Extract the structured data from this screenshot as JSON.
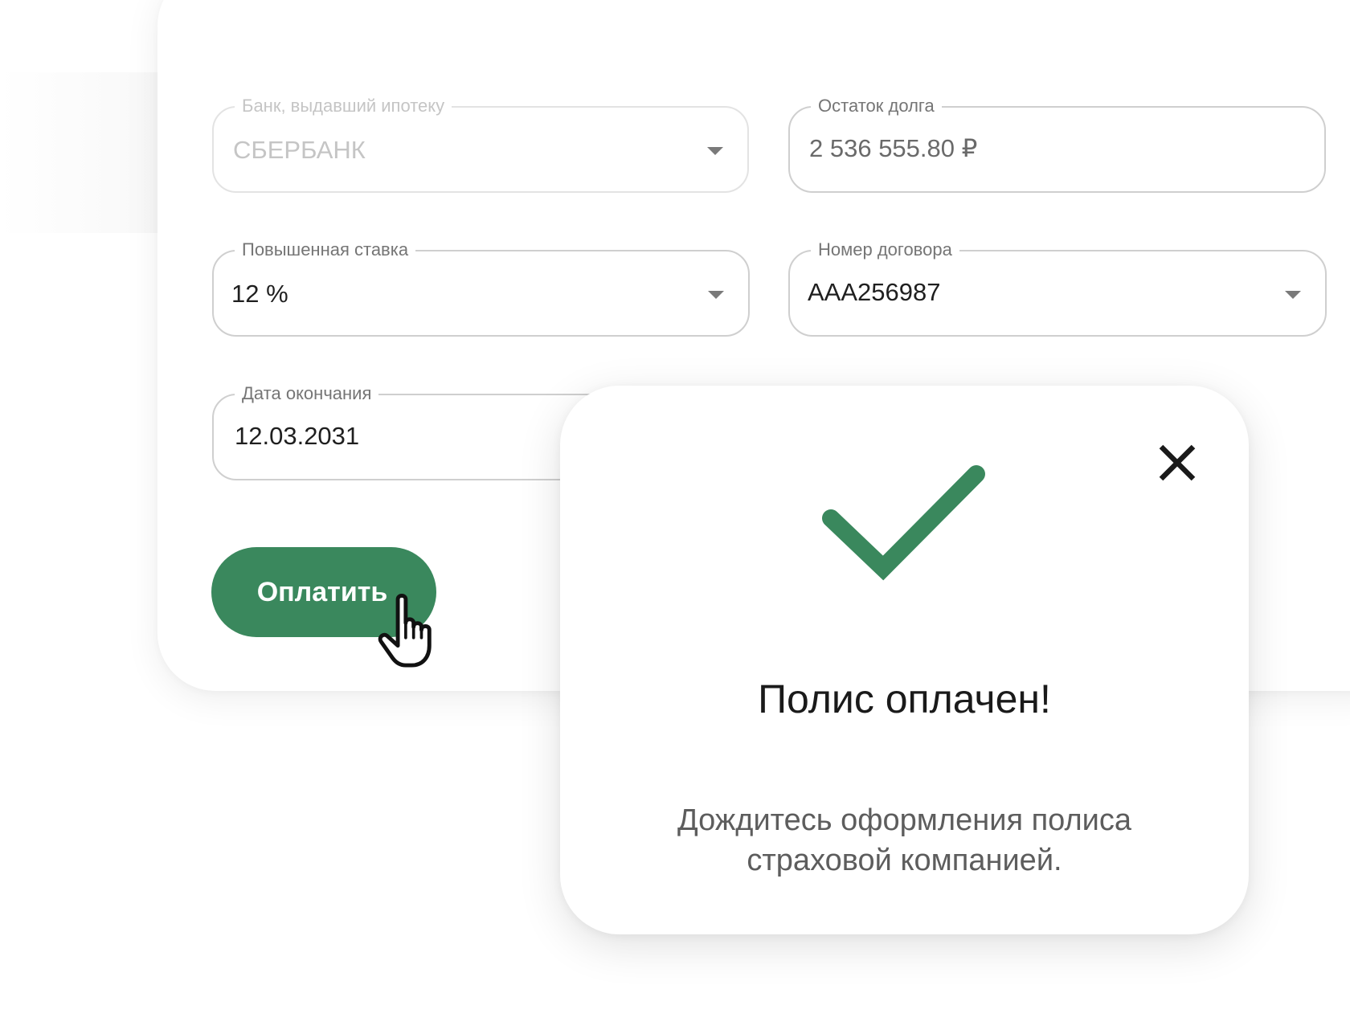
{
  "form": {
    "bank": {
      "label": "Банк, выдавший ипотеку",
      "value": "СБЕРБАНК",
      "disabled": true
    },
    "debt": {
      "label": "Остаток долга",
      "value": "2 536 555.80  ₽"
    },
    "rate": {
      "label": "Повышенная ставка",
      "value": "12 %"
    },
    "contract": {
      "label": "Номер договора",
      "value": "AAA256987"
    },
    "end_date": {
      "label": "Дата окончания",
      "value": "12.03.2031"
    },
    "pay_button": "Оплатить"
  },
  "modal": {
    "title": "Полис оплачен!",
    "message_line1": "Дождитесь оформления полиса",
    "message_line2": "страховой компанией."
  },
  "icons": {
    "success": "check-icon",
    "close": "close-icon",
    "dropdown": "chevron-down-icon",
    "cursor": "hand-pointer-icon"
  },
  "colors": {
    "accent": "#3a885d",
    "text": "#1f1f1f",
    "muted_text": "#5d5d5d",
    "border": "#cfcfcf"
  }
}
